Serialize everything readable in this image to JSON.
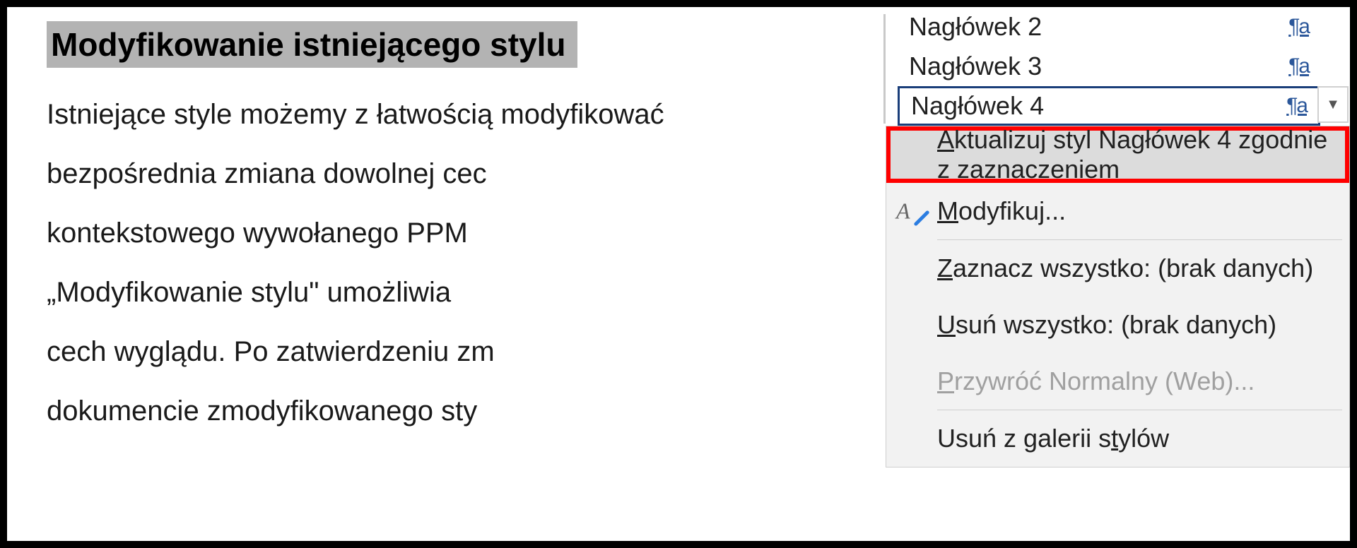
{
  "document": {
    "heading": "Modyfikowanie istniejącego stylu",
    "body_lines": [
      "Istniejące style możemy z łatwością modyfikować",
      "bezpośrednia zmiana dowolnej cec",
      "kontekstowego wywołanego PPM",
      "„Modyfikowanie stylu\" umożliwia",
      "cech wyglądu. Po zatwierdzeniu zm",
      "dokumencie zmodyfikowanego sty"
    ]
  },
  "styles_pane": {
    "items": [
      {
        "label": "Nagłówek 2",
        "marker": "¶a",
        "selected": false
      },
      {
        "label": "Nagłówek 3",
        "marker": "¶a",
        "selected": false
      },
      {
        "label": "Nagłówek 4",
        "marker": "¶a",
        "selected": true
      }
    ]
  },
  "context_menu": {
    "update": {
      "prefix": "A",
      "rest": "ktualizuj styl Nagłówek 4 zgodnie z zaznaczeniem"
    },
    "modify": {
      "prefix": "M",
      "rest": "odyfikuj..."
    },
    "select_all": {
      "prefix": "Z",
      "rest": "aznacz wszystko: (brak danych)"
    },
    "delete_all": {
      "prefix": "U",
      "rest": "suń wszystko: (brak danych)"
    },
    "restore": {
      "prefix": "P",
      "rest": "rzywróć Normalny (Web)..."
    },
    "remove_gallery": {
      "prefix_plain": "Usuń z galerii s",
      "underlined": "t",
      "suffix": "ylów"
    }
  }
}
